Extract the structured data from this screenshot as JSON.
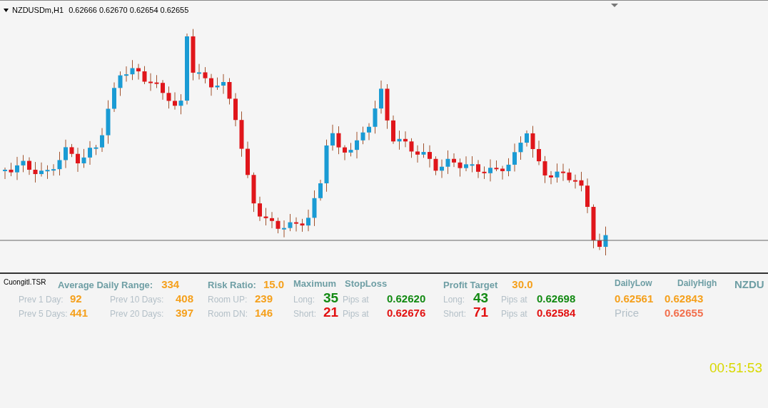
{
  "chart": {
    "symbol": "NZDUSDm,H1",
    "ohlc": "0.62666 0.62670 0.62654 0.62655"
  },
  "indicator": {
    "name": "Cuongitl.TSR",
    "sections": [
      {
        "header": [
          {
            "kind": "title",
            "text": "Average Daily Range:"
          },
          {
            "kind": "value",
            "text": "334"
          }
        ],
        "rows": [
          [
            {
              "kind": "label",
              "text": "Prev 1 Day:"
            },
            {
              "kind": "value",
              "text": "92"
            },
            {
              "kind": "label",
              "text": "Prev 10 Days:"
            },
            {
              "kind": "value",
              "text": "408"
            }
          ],
          [
            {
              "kind": "label",
              "text": "Prev 5 Days:"
            },
            {
              "kind": "value",
              "text": "441"
            },
            {
              "kind": "label",
              "text": "Prev 20 Days:"
            },
            {
              "kind": "value",
              "text": "397"
            }
          ]
        ]
      },
      {
        "header": [
          {
            "kind": "title",
            "text": "Risk Ratio:"
          },
          {
            "kind": "value",
            "text": "15.0"
          }
        ],
        "rows": [
          [
            {
              "kind": "label",
              "text": "Room UP:"
            },
            {
              "kind": "value",
              "text": "239"
            }
          ],
          [
            {
              "kind": "label",
              "text": "Room DN:"
            },
            {
              "kind": "value",
              "text": "146"
            }
          ]
        ]
      },
      {
        "header": [
          {
            "kind": "title",
            "text": "Maximum"
          },
          {
            "kind": "title",
            "text": "StopLoss"
          }
        ],
        "rows": [
          [
            {
              "kind": "label",
              "text": "Long:"
            },
            {
              "kind": "count_up",
              "text": "35"
            },
            {
              "kind": "label",
              "text": "Pips at"
            },
            {
              "kind": "price_up",
              "text": "0.62620"
            }
          ],
          [
            {
              "kind": "label",
              "text": "Short:"
            },
            {
              "kind": "count_down",
              "text": "21"
            },
            {
              "kind": "label",
              "text": "Pips at"
            },
            {
              "kind": "price_down",
              "text": "0.62676"
            }
          ]
        ]
      },
      {
        "header": [
          {
            "kind": "title",
            "text": "Profit Target"
          },
          {
            "kind": "value",
            "text": "30.0"
          }
        ],
        "rows": [
          [
            {
              "kind": "label",
              "text": "Long:"
            },
            {
              "kind": "count_up",
              "text": "43"
            },
            {
              "kind": "label",
              "text": "Pips at"
            },
            {
              "kind": "price_up",
              "text": "0.62698"
            }
          ],
          [
            {
              "kind": "label",
              "text": "Short:"
            },
            {
              "kind": "count_down",
              "text": "71"
            },
            {
              "kind": "label",
              "text": "Pips at"
            },
            {
              "kind": "price_down",
              "text": "0.62584"
            }
          ]
        ]
      },
      {
        "header": [
          {
            "kind": "small_title",
            "text": "DailyLow"
          },
          {
            "kind": "small_title",
            "text": "DailyHigh"
          }
        ],
        "rows": [
          [
            {
              "kind": "value",
              "text": "0.62561"
            },
            {
              "kind": "value",
              "text": "0.62843"
            }
          ],
          [
            {
              "kind": "big_label",
              "text": "Price"
            },
            {
              "kind": "price",
              "text": "0.62655"
            }
          ]
        ]
      },
      {
        "header": [
          {
            "kind": "symbol",
            "text": "NZDU"
          }
        ]
      }
    ],
    "clock": "00:51:53"
  }
}
